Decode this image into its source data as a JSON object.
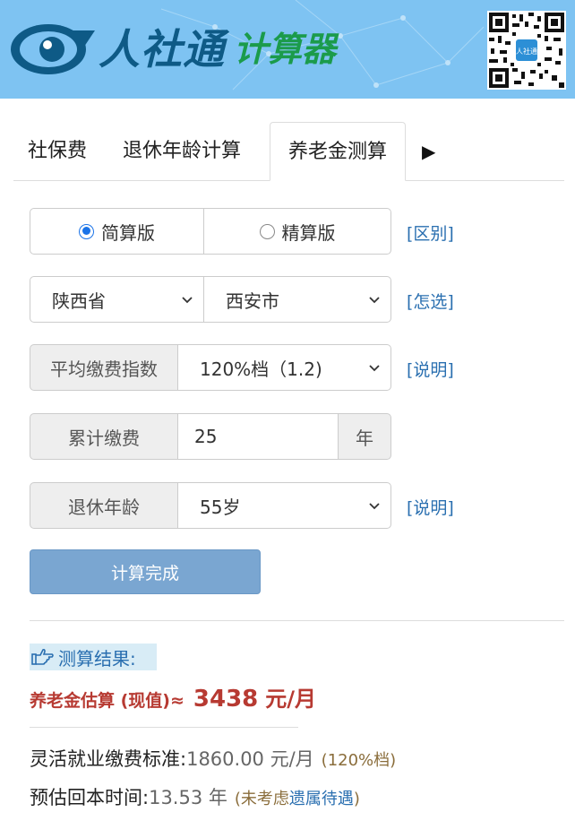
{
  "header": {
    "logo_text": "人社通",
    "logo_sub": "计算器",
    "qr_label": "人社通"
  },
  "tabs": [
    {
      "label": "社保费"
    },
    {
      "label": "退休年龄计算"
    },
    {
      "label": "养老金测算"
    },
    {
      "label": "▶"
    }
  ],
  "form": {
    "version": {
      "simple": "简算版",
      "precise": "精算版",
      "selected": "simple",
      "hint": "[区别]"
    },
    "region": {
      "province": "陕西省",
      "city": "西安市",
      "hint": "[怎选]"
    },
    "index": {
      "label": "平均缴费指数",
      "value": "120%档（1.2)",
      "hint": "[说明]"
    },
    "years": {
      "label": "累计缴费",
      "value": "25",
      "unit": "年"
    },
    "retire_age": {
      "label": "退休年龄",
      "value": "55岁",
      "hint": "[说明]"
    },
    "submit": "计算完成"
  },
  "result": {
    "heading": "测算结果:",
    "pension_label": "养老金估算 (现值)≈",
    "pension_value": "3438",
    "pension_unit": "元/月",
    "standard_label": "灵活就业缴费标准:",
    "standard_value": "1860.00 元/月",
    "standard_note": "(120%档)",
    "payback_label": "预估回本时间:",
    "payback_value": "13.53 年",
    "payback_note_pre": "(未考虑",
    "payback_note_link": "遗属待遇",
    "payback_note_post": ")"
  },
  "colors": {
    "banner": "#7ec3f2",
    "link": "#2a6fb0",
    "result_red": "#b73a32",
    "button": "#7aa6d1"
  }
}
